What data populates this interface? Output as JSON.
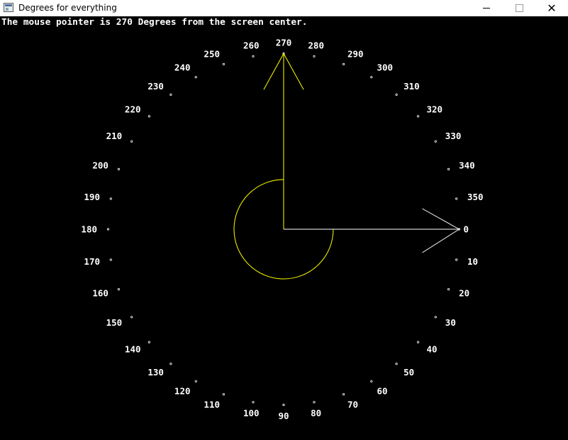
{
  "window": {
    "title": "Degrees for everything",
    "controls": {
      "minimize": "minimize-icon",
      "maximize": "maximize-icon",
      "close": "close-icon"
    }
  },
  "status_text": "The mouse pointer is 270 Degrees from the screen center.",
  "pointer_angle": 270,
  "ticks": [
    "0",
    "10",
    "20",
    "30",
    "40",
    "50",
    "60",
    "70",
    "80",
    "90",
    "100",
    "110",
    "120",
    "130",
    "140",
    "150",
    "160",
    "170",
    "180",
    "190",
    "200",
    "210",
    "220",
    "230",
    "240",
    "250",
    "260",
    "270",
    "280",
    "290",
    "300",
    "310",
    "320",
    "330",
    "340",
    "350"
  ],
  "colors": {
    "background": "#000000",
    "text": "#ffffff",
    "arrow": "#ffff00",
    "reference": "#ffffff"
  }
}
